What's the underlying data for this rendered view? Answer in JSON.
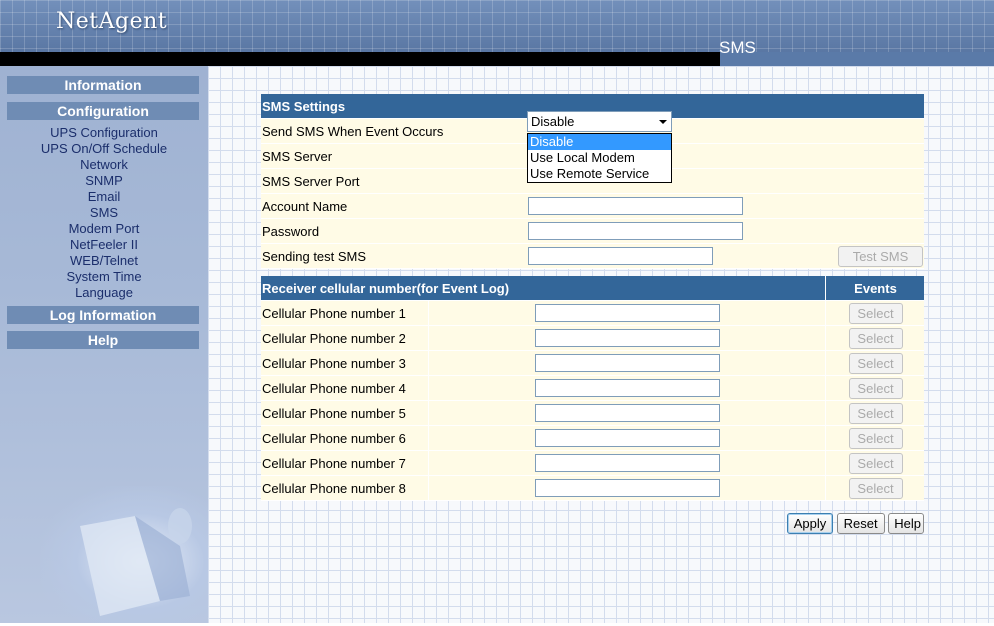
{
  "header": {
    "logo": "NetAgent",
    "page_title": "SMS"
  },
  "sidebar": {
    "sections": [
      {
        "label": "Information"
      },
      {
        "label": "Configuration"
      },
      {
        "label": "Log Information"
      },
      {
        "label": "Help"
      }
    ],
    "config_items": [
      "UPS Configuration",
      "UPS On/Off Schedule",
      "Network",
      "SNMP",
      "Email",
      "SMS",
      "Modem Port",
      "NetFeeler II",
      "WEB/Telnet",
      "System Time",
      "Language"
    ]
  },
  "sms_settings": {
    "title": "SMS Settings",
    "send_label": "Send SMS When Event Occurs",
    "send_value": "Disable",
    "send_options": [
      "Disable",
      "Use Local Modem",
      "Use Remote Service"
    ],
    "server_label": "SMS Server",
    "port_label": "SMS Server Port",
    "account_label": "Account Name",
    "password_label": "Password",
    "test_label": "Sending test SMS",
    "test_button": "Test SMS"
  },
  "receivers": {
    "title": "Receiver cellular number(for Event Log)",
    "events_header": "Events",
    "select_label": "Select",
    "rows": [
      "Cellular Phone number 1",
      "Cellular Phone number 2",
      "Cellular Phone number 3",
      "Cellular Phone number 4",
      "Cellular Phone number 5",
      "Cellular Phone number 6",
      "Cellular Phone number 7",
      "Cellular Phone number 8"
    ]
  },
  "actions": {
    "apply": "Apply",
    "reset": "Reset",
    "help": "Help"
  }
}
